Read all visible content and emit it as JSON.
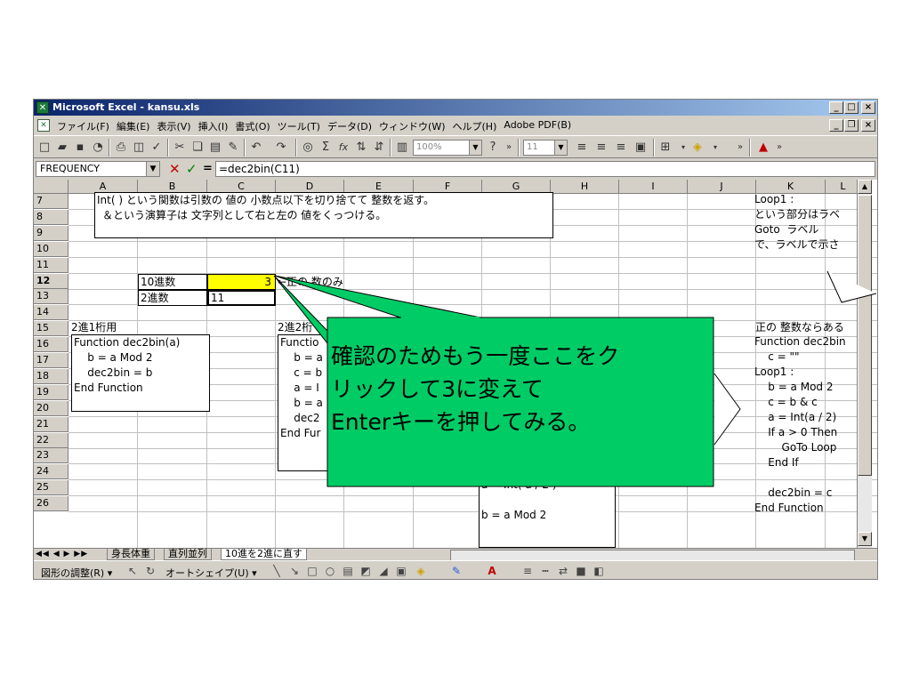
{
  "window": {
    "title": "Microsoft Excel - kansu.xls",
    "minimize": "_",
    "maximize": "□",
    "close": "×"
  },
  "menu": {
    "items": [
      "ファイル(F)",
      "編集(E)",
      "表示(V)",
      "挿入(I)",
      "書式(O)",
      "ツール(T)",
      "データ(D)",
      "ウィンドウ(W)",
      "ヘルプ(H)",
      "Adobe PDF(B)"
    ]
  },
  "toolbar": {
    "zoom": "100%",
    "font_size": "11",
    "sum_symbol": "Σ",
    "fx_symbol": "fx"
  },
  "formula_bar": {
    "name_box": "FREQUENCY",
    "cancel_symbol": "✕",
    "enter_symbol": "✓",
    "equals_symbol": "=",
    "formula": "=dec2bin(C11)"
  },
  "columns": [
    "A",
    "B",
    "C",
    "D",
    "E",
    "F",
    "G",
    "H",
    "I",
    "J",
    "K",
    "L"
  ],
  "rows": [
    "7",
    "8",
    "9",
    "10",
    "11",
    "12",
    "13",
    "14",
    "15",
    "16",
    "17",
    "18",
    "19",
    "20",
    "21",
    "22",
    "23",
    "24",
    "25",
    "26"
  ],
  "cells": {
    "b11": "10進数",
    "c11": "3",
    "d11_arrow_label": "←正の 数のみ",
    "b12": "2進数",
    "c12": "11",
    "a14": "2進1桁用",
    "d14": "2進2桁",
    "k14": "正の 整数ならある"
  },
  "note_box": {
    "line1": "Int( ) という関数は引数の 値の 小数点以下を切り捨てて 整数を返す。",
    "line2": "＆という演算子は 文字列として右と左の 値をくっつける。"
  },
  "code_box_a": {
    "lines": [
      "Function dec2bin(a)",
      "    b = a Mod 2",
      "    dec2bin = b",
      "End Function"
    ]
  },
  "code_box_d": {
    "lines": [
      "Functio",
      "    b = a",
      "    c = b",
      "    a = I",
      "    b = a",
      "    dec2",
      "End Fur"
    ]
  },
  "code_box_g": {
    "lines": [
      "b = a Mod 2",
      "c = b & c",
      "a = Int( a / 2 )",
      "",
      "b = a Mod 2"
    ]
  },
  "code_box_k_top": {
    "lines": [
      "Loop1 :",
      "という部分はラベ",
      "Goto  ラベル",
      "で、ラベルで示さ"
    ]
  },
  "code_box_k": {
    "lines": [
      "Function dec2bin",
      "    c = \"\"",
      "Loop1 :",
      "    b = a Mod 2",
      "    c = b & c",
      "    a = Int(a / 2)",
      "    If a > 0 Then",
      "        GoTo Loop",
      "    End If",
      "",
      "    dec2bin = c",
      "End Function"
    ]
  },
  "callout": {
    "line1": "確認のためもう一度ここをク",
    "line2": "リックして3に変えて",
    "line3": "Enterキーを押してみる。",
    "fill": "#22c55e",
    "note_fill": "#00cc66"
  },
  "sheet_tabs": {
    "nav": "◀◀ ◀ ▶ ▶▶",
    "tabs": [
      "身長体重",
      "直列並列",
      "10進を2進に直す"
    ],
    "active": "10進を2進に直す"
  },
  "draw_toolbar": {
    "adjust": "図形の調整(R) ▾",
    "autoshape": "オートシェイプ(U) ▾"
  },
  "colors": {
    "selected_cell": "#ffff00",
    "callout": "#00cc66",
    "title_bar": "#0a246a"
  }
}
